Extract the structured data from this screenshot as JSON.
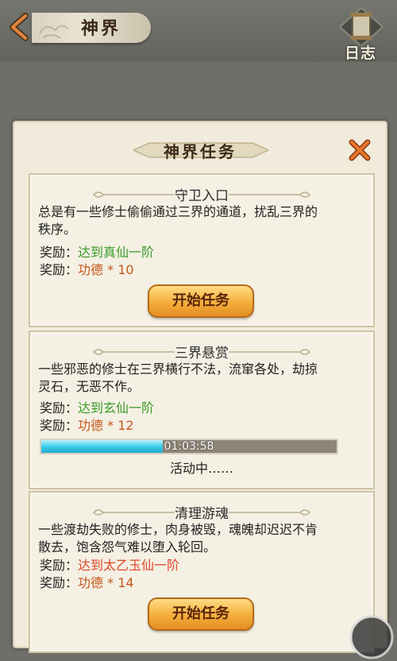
{
  "header": {
    "title": "神界",
    "log_label": "日志"
  },
  "panel": {
    "title": "神界任务"
  },
  "tasks": [
    {
      "title": "守卫入口",
      "desc": "总是有一些修士偷偷通过三界的通道，扰乱三界的秩序。",
      "reward_prefix": "奖励：",
      "reward1": "达到真仙一阶",
      "reward2": "功德 * 10",
      "button": "开始任务"
    },
    {
      "title": "三界悬赏",
      "desc": "一些邪恶的修士在三界横行不法，流窜各处，劫掠灵石，无恶不作。",
      "reward_prefix": "奖励：",
      "reward1": "达到玄仙一阶",
      "reward2": "功德 * 12",
      "timer": "01:03:58",
      "progress": 0.41,
      "status": "活动中……"
    },
    {
      "title": "清理游魂",
      "desc": "一些渡劫失败的修士，肉身被毁，魂魄却迟迟不肯散去，饱含怨气难以堕入轮回。",
      "reward_prefix": "奖励：",
      "reward1": "达到太乙玉仙一阶",
      "reward2": "功德 * 14",
      "button": "开始任务"
    }
  ],
  "colors": {
    "reward_green": "#3b9c28",
    "reward_red": "#e0452a",
    "reward_orange": "#c4561c",
    "progress_fill": "#3bcdeb"
  },
  "icons": [
    "back-arrow-icon",
    "scroll-log-icon",
    "close-icon",
    "ornament-icon"
  ]
}
